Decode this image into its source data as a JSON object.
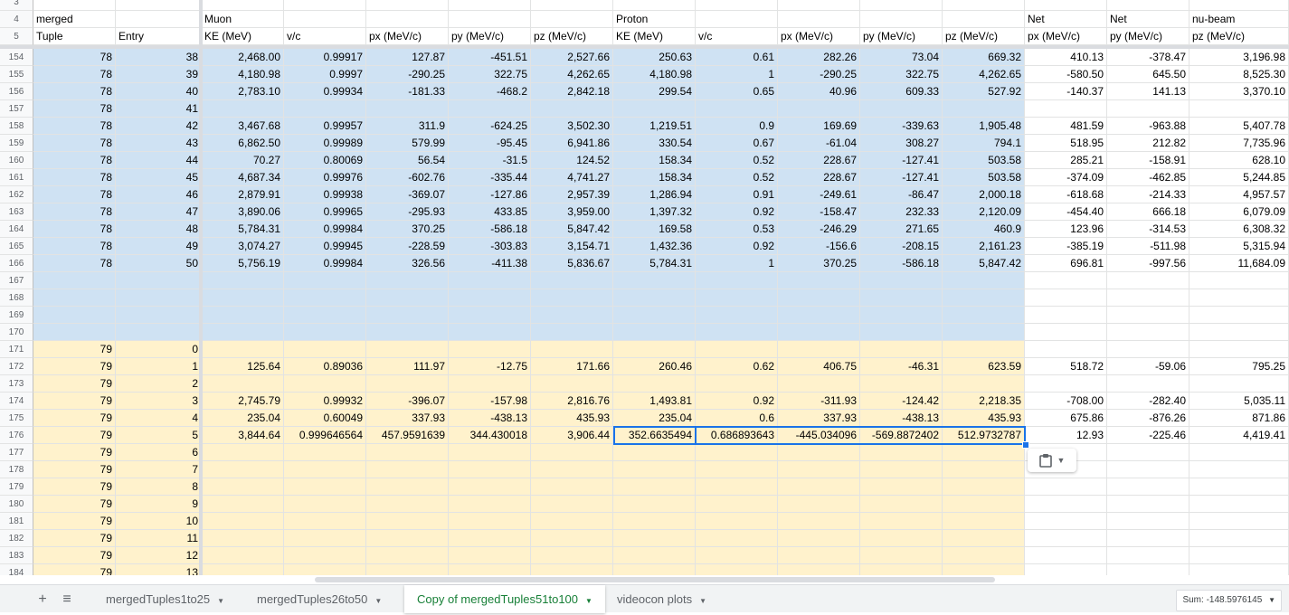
{
  "colors": {
    "blue_fill": "#cfe2f3",
    "yellow_fill": "#fff2cc",
    "selection": "#1a73e8",
    "active_tab": "#188038"
  },
  "header_rows": [
    {
      "row_num": "3",
      "cells": [
        "",
        "",
        "",
        "",
        "",
        "",
        "",
        "",
        "",
        "",
        "",
        "",
        "",
        "",
        ""
      ]
    },
    {
      "row_num": "4",
      "cells": [
        "merged",
        "",
        "Muon",
        "",
        "",
        "",
        "",
        "Proton",
        "",
        "",
        "",
        "",
        "Net",
        "Net",
        "nu-beam"
      ]
    },
    {
      "row_num": "5",
      "cells": [
        "Tuple",
        "Entry",
        "KE (MeV)",
        "v/c",
        "px (MeV/c)",
        "py (MeV/c)",
        "pz (MeV/c)",
        "KE (MeV)",
        "v/c",
        "px (MeV/c)",
        "py (MeV/c)",
        "pz (MeV/c)",
        "px (MeV/c)",
        "py (MeV/c)",
        "pz (MeV/c)"
      ]
    }
  ],
  "rows": [
    {
      "row_num": "154",
      "cells": [
        "78",
        "38",
        "2,468.00",
        "0.99917",
        "127.87",
        "-451.51",
        "2,527.66",
        "250.63",
        "0.61",
        "282.26",
        "73.04",
        "669.32",
        "410.13",
        "-378.47",
        "3,196.98"
      ]
    },
    {
      "row_num": "155",
      "cells": [
        "78",
        "39",
        "4,180.98",
        "0.9997",
        "-290.25",
        "322.75",
        "4,262.65",
        "4,180.98",
        "1",
        "-290.25",
        "322.75",
        "4,262.65",
        "-580.50",
        "645.50",
        "8,525.30"
      ]
    },
    {
      "row_num": "156",
      "cells": [
        "78",
        "40",
        "2,783.10",
        "0.99934",
        "-181.33",
        "-468.2",
        "2,842.18",
        "299.54",
        "0.65",
        "40.96",
        "609.33",
        "527.92",
        "-140.37",
        "141.13",
        "3,370.10"
      ]
    },
    {
      "row_num": "157",
      "cells": [
        "78",
        "41",
        "",
        "",
        "",
        "",
        "",
        "",
        "",
        "",
        "",
        "",
        "",
        "",
        ""
      ]
    },
    {
      "row_num": "158",
      "cells": [
        "78",
        "42",
        "3,467.68",
        "0.99957",
        "311.9",
        "-624.25",
        "3,502.30",
        "1,219.51",
        "0.9",
        "169.69",
        "-339.63",
        "1,905.48",
        "481.59",
        "-963.88",
        "5,407.78"
      ]
    },
    {
      "row_num": "159",
      "cells": [
        "78",
        "43",
        "6,862.50",
        "0.99989",
        "579.99",
        "-95.45",
        "6,941.86",
        "330.54",
        "0.67",
        "-61.04",
        "308.27",
        "794.1",
        "518.95",
        "212.82",
        "7,735.96"
      ]
    },
    {
      "row_num": "160",
      "cells": [
        "78",
        "44",
        "70.27",
        "0.80069",
        "56.54",
        "-31.5",
        "124.52",
        "158.34",
        "0.52",
        "228.67",
        "-127.41",
        "503.58",
        "285.21",
        "-158.91",
        "628.10"
      ]
    },
    {
      "row_num": "161",
      "cells": [
        "78",
        "45",
        "4,687.34",
        "0.99976",
        "-602.76",
        "-335.44",
        "4,741.27",
        "158.34",
        "0.52",
        "228.67",
        "-127.41",
        "503.58",
        "-374.09",
        "-462.85",
        "5,244.85"
      ]
    },
    {
      "row_num": "162",
      "cells": [
        "78",
        "46",
        "2,879.91",
        "0.99938",
        "-369.07",
        "-127.86",
        "2,957.39",
        "1,286.94",
        "0.91",
        "-249.61",
        "-86.47",
        "2,000.18",
        "-618.68",
        "-214.33",
        "4,957.57"
      ]
    },
    {
      "row_num": "163",
      "cells": [
        "78",
        "47",
        "3,890.06",
        "0.99965",
        "-295.93",
        "433.85",
        "3,959.00",
        "1,397.32",
        "0.92",
        "-158.47",
        "232.33",
        "2,120.09",
        "-454.40",
        "666.18",
        "6,079.09"
      ]
    },
    {
      "row_num": "164",
      "cells": [
        "78",
        "48",
        "5,784.31",
        "0.99984",
        "370.25",
        "-586.18",
        "5,847.42",
        "169.58",
        "0.53",
        "-246.29",
        "271.65",
        "460.9",
        "123.96",
        "-314.53",
        "6,308.32"
      ]
    },
    {
      "row_num": "165",
      "cells": [
        "78",
        "49",
        "3,074.27",
        "0.99945",
        "-228.59",
        "-303.83",
        "3,154.71",
        "1,432.36",
        "0.92",
        "-156.6",
        "-208.15",
        "2,161.23",
        "-385.19",
        "-511.98",
        "5,315.94"
      ]
    },
    {
      "row_num": "166",
      "cells": [
        "78",
        "50",
        "5,756.19",
        "0.99984",
        "326.56",
        "-411.38",
        "5,836.67",
        "5,784.31",
        "1",
        "370.25",
        "-586.18",
        "5,847.42",
        "696.81",
        "-997.56",
        "11,684.09"
      ]
    },
    {
      "row_num": "167",
      "cells": [
        "",
        "",
        "",
        "",
        "",
        "",
        "",
        "",
        "",
        "",
        "",
        "",
        "",
        "",
        ""
      ]
    },
    {
      "row_num": "168",
      "cells": [
        "",
        "",
        "",
        "",
        "",
        "",
        "",
        "",
        "",
        "",
        "",
        "",
        "",
        "",
        ""
      ]
    },
    {
      "row_num": "169",
      "cells": [
        "",
        "",
        "",
        "",
        "",
        "",
        "",
        "",
        "",
        "",
        "",
        "",
        "",
        "",
        ""
      ]
    },
    {
      "row_num": "170",
      "cells": [
        "",
        "",
        "",
        "",
        "",
        "",
        "",
        "",
        "",
        "",
        "",
        "",
        "",
        "",
        ""
      ]
    },
    {
      "row_num": "171",
      "cells": [
        "79",
        "0",
        "",
        "",
        "",
        "",
        "",
        "",
        "",
        "",
        "",
        "",
        "",
        "",
        ""
      ]
    },
    {
      "row_num": "172",
      "cells": [
        "79",
        "1",
        "125.64",
        "0.89036",
        "111.97",
        "-12.75",
        "171.66",
        "260.46",
        "0.62",
        "406.75",
        "-46.31",
        "623.59",
        "518.72",
        "-59.06",
        "795.25"
      ]
    },
    {
      "row_num": "173",
      "cells": [
        "79",
        "2",
        "",
        "",
        "",
        "",
        "",
        "",
        "",
        "",
        "",
        "",
        "",
        "",
        ""
      ]
    },
    {
      "row_num": "174",
      "cells": [
        "79",
        "3",
        "2,745.79",
        "0.99932",
        "-396.07",
        "-157.98",
        "2,816.76",
        "1,493.81",
        "0.92",
        "-311.93",
        "-124.42",
        "2,218.35",
        "-708.00",
        "-282.40",
        "5,035.11"
      ]
    },
    {
      "row_num": "175",
      "cells": [
        "79",
        "4",
        "235.04",
        "0.60049",
        "337.93",
        "-438.13",
        "435.93",
        "235.04",
        "0.6",
        "337.93",
        "-438.13",
        "435.93",
        "675.86",
        "-876.26",
        "871.86"
      ]
    },
    {
      "row_num": "176",
      "cells": [
        "79",
        "5",
        "3,844.64",
        "0.999646564",
        "457.9591639",
        "344.430018",
        "3,906.44",
        "352.6635494",
        "0.686893643",
        "-445.034096",
        "-569.8872402",
        "512.9732787",
        "12.93",
        "-225.46",
        "4,419.41"
      ]
    },
    {
      "row_num": "177",
      "cells": [
        "79",
        "6",
        "",
        "",
        "",
        "",
        "",
        "",
        "",
        "",
        "",
        "",
        "",
        "",
        ""
      ]
    },
    {
      "row_num": "178",
      "cells": [
        "79",
        "7",
        "",
        "",
        "",
        "",
        "",
        "",
        "",
        "",
        "",
        "",
        "",
        "",
        ""
      ]
    },
    {
      "row_num": "179",
      "cells": [
        "79",
        "8",
        "",
        "",
        "",
        "",
        "",
        "",
        "",
        "",
        "",
        "",
        "",
        "",
        ""
      ]
    },
    {
      "row_num": "180",
      "cells": [
        "79",
        "9",
        "",
        "",
        "",
        "",
        "",
        "",
        "",
        "",
        "",
        "",
        "",
        "",
        ""
      ]
    },
    {
      "row_num": "181",
      "cells": [
        "79",
        "10",
        "",
        "",
        "",
        "",
        "",
        "",
        "",
        "",
        "",
        "",
        "",
        "",
        ""
      ]
    },
    {
      "row_num": "182",
      "cells": [
        "79",
        "11",
        "",
        "",
        "",
        "",
        "",
        "",
        "",
        "",
        "",
        "",
        "",
        "",
        ""
      ]
    },
    {
      "row_num": "183",
      "cells": [
        "79",
        "12",
        "",
        "",
        "",
        "",
        "",
        "",
        "",
        "",
        "",
        "",
        "",
        "",
        ""
      ]
    },
    {
      "row_num": "184",
      "cells": [
        "79",
        "13",
        "",
        "",
        "",
        "",
        "",
        "",
        "",
        "",
        "",
        "",
        "",
        "",
        ""
      ]
    }
  ],
  "tabbar": {
    "add_icon": "+",
    "menu_icon": "≡",
    "tabs": [
      {
        "label": "mergedTuples1to25",
        "active": false
      },
      {
        "label": "mergedTuples26to50",
        "active": false
      },
      {
        "label": "Copy of mergedTuples51to100",
        "active": true
      },
      {
        "label": "videocon plots",
        "active": false
      }
    ],
    "sum_label": "Sum: -148.5976145"
  },
  "paste_icon": "clipboard-icon"
}
